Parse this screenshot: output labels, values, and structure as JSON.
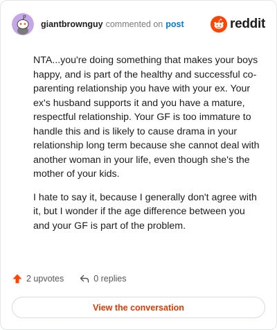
{
  "header": {
    "username": "giantbrownguy",
    "action": "commented on",
    "post_link": "post",
    "brand": "reddit"
  },
  "comment": {
    "paragraphs": [
      "NTA...you're doing something that makes your boys happy, and is part of the healthy and successful co-parenting relationship you have with your ex. Your ex's husband supports it and you have a mature, respectful relationship. Your GF is too immature to handle this and is likely to cause drama in your relationship long term because she cannot deal with another woman in your life, even though she's the mother of your kids.",
      "I hate to say it, because I generally don't agree with it, but I wonder if the age difference between you and your GF is part of the problem."
    ]
  },
  "footer": {
    "upvotes": "2 upvotes",
    "replies": "0 replies",
    "cta": "View the conversation"
  },
  "colors": {
    "accent_orange": "#ff4500",
    "cta_text": "#d93a00",
    "link_blue": "#0079d3",
    "avatar_bg": "#c6a7e6"
  },
  "icons": {
    "avatar": "snoo-avatar-icon",
    "brand": "reddit-logo-icon",
    "upvote": "upvote-arrow-icon",
    "reply": "reply-arrow-icon"
  }
}
